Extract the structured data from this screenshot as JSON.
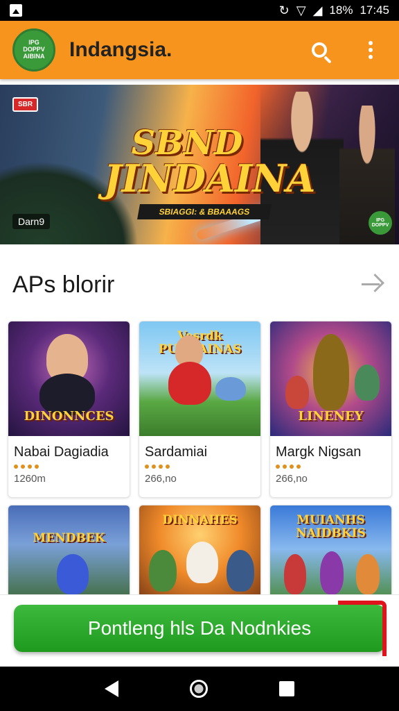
{
  "status_bar": {
    "battery": "18%",
    "time": "17:45"
  },
  "app_bar": {
    "logo_lines": [
      "IPG",
      "DOPPV",
      "AIBINA"
    ],
    "title": "Indangsia."
  },
  "banner": {
    "badge": "SBR",
    "title_line1": "SBND",
    "title_line2": "JINDAINA",
    "subtitle": "SBIAGGI: & BBAAAGS",
    "caption": "Darn9",
    "corner_logo": "IPG DOPPV"
  },
  "section": {
    "title": "APs blorir"
  },
  "cards": [
    {
      "thumb_text": "DINONNCES",
      "name": "Nabai Dagiadia",
      "meta": "1260m"
    },
    {
      "thumb_text": "Vesrdk PUBNAINAS",
      "name": "Sardamiai",
      "meta": "266,no"
    },
    {
      "thumb_text": "LINENEY",
      "name": "Margk Nigsan",
      "meta": "266,no"
    },
    {
      "thumb_text": "MENDBEK",
      "name": "",
      "meta": ""
    },
    {
      "thumb_text": "DINNAHES",
      "name": "",
      "meta": ""
    },
    {
      "thumb_text": "MUIANHS NAIDBKIS",
      "name": "",
      "meta": ""
    }
  ],
  "install_button": {
    "label": "Pontleng hls Da Nodnkies"
  },
  "colors": {
    "app_bar": "#f7941d",
    "install": "#27a827",
    "rating": "#e0901c"
  }
}
